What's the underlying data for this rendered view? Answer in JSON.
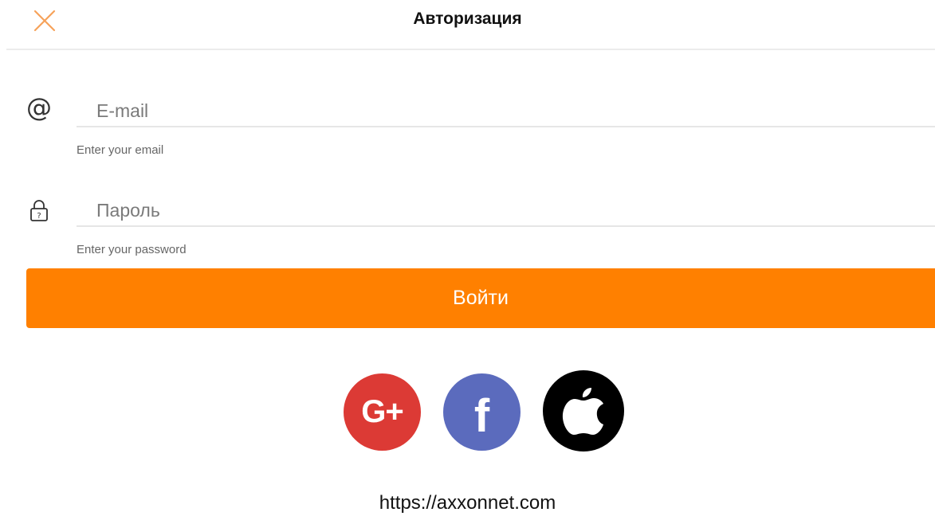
{
  "header": {
    "title": "Авторизация",
    "close_icon": "close-icon"
  },
  "form": {
    "email": {
      "icon": "at-icon",
      "icon_glyph": "@",
      "placeholder": "E-mail",
      "value": "",
      "hint": "Enter your email"
    },
    "password": {
      "icon": "lock-icon",
      "placeholder": "Пароль",
      "value": "",
      "hint": "Enter your password"
    },
    "submit_label": "Войти"
  },
  "social": {
    "google": {
      "icon": "google-plus-icon",
      "label": "G+",
      "color": "#dc3a35"
    },
    "facebook": {
      "icon": "facebook-icon",
      "label": "f",
      "color": "#5b6bbd"
    },
    "apple": {
      "icon": "apple-icon",
      "color": "#000000"
    }
  },
  "footer": {
    "url": "https://axxonnet.com"
  },
  "colors": {
    "accent": "#ff8000",
    "close_icon": "#f6a25a"
  }
}
